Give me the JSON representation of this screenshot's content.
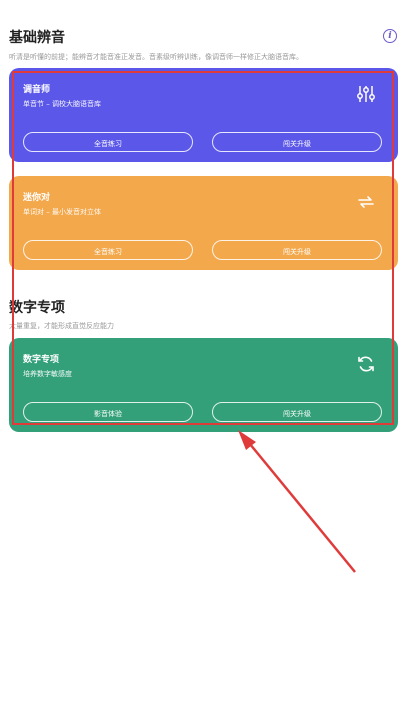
{
  "section1": {
    "title": "基础辨音",
    "desc": "听清是听懂的前提；能辨音才能音准正发音。音素级听辨训练，像调音师一样修正大脑语音库。"
  },
  "cards": [
    {
      "title": "调音师",
      "subtitle": "单音节 – 调校大脑语音库",
      "icon": "sliders-icon",
      "btn_left": "全音练习",
      "btn_right": "闯关升级",
      "color": "#5b57e9"
    },
    {
      "title": "迷你对",
      "subtitle": "单词对 – 最小发音对立体",
      "icon": "swap-arrows-icon",
      "btn_left": "全音练习",
      "btn_right": "闯关升级",
      "color": "#f3a84c"
    },
    {
      "title": "数字专项",
      "subtitle": "培养数字敏感度",
      "icon": "refresh-icon",
      "btn_left": "影音体验",
      "btn_right": "闯关升级",
      "color": "#33a07a"
    }
  ],
  "section2": {
    "title": "数字专项",
    "desc": "大量重复，才能形成直觉反应能力"
  },
  "annotation_color": "#e03b3b"
}
